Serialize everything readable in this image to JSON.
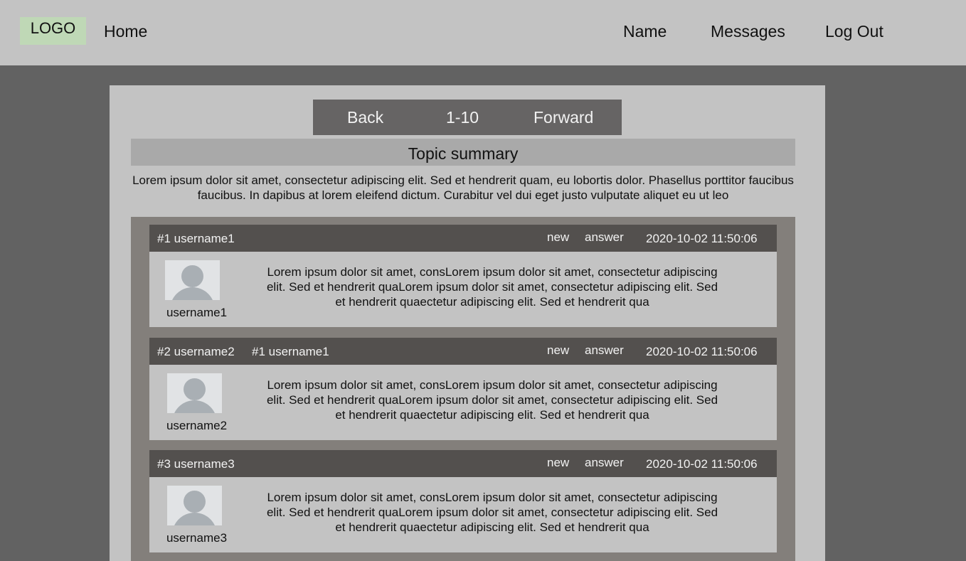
{
  "header": {
    "logo": "LOGO",
    "home": "Home",
    "name": "Name",
    "messages": "Messages",
    "logout": "Log Out"
  },
  "pager": {
    "back": "Back",
    "range": "1-10",
    "forward": "Forward"
  },
  "topic": {
    "title": "Topic summary",
    "summary": "Lorem ipsum dolor sit amet, consectetur adipiscing elit. Sed et hendrerit quam, eu lobortis dolor. Phasellus porttitor faucibus faucibus. In dapibus at lorem eleifend dictum. Curabitur vel dui eget justo vulputate aliquet eu ut leo"
  },
  "posts": [
    {
      "title": "#1 username1",
      "reply_to": "",
      "new_label": "new",
      "answer_label": "answer",
      "date": "2020-10-02 11:50:06",
      "avatar_name": "username1",
      "text": "Lorem ipsum dolor sit amet, consLorem ipsum dolor sit amet, consectetur adipiscing elit. Sed et hendrerit quaLorem ipsum dolor sit amet, consectetur adipiscing elit. Sed et hendrerit quaectetur adipiscing elit. Sed et hendrerit qua"
    },
    {
      "title": "#2 username2",
      "reply_to": "#1 username1",
      "new_label": "new",
      "answer_label": "answer",
      "date": "2020-10-02 11:50:06",
      "avatar_name": "username2",
      "text": "Lorem ipsum dolor sit amet, consLorem ipsum dolor sit amet, consectetur adipiscing elit. Sed et hendrerit quaLorem ipsum dolor sit amet, consectetur adipiscing elit. Sed et hendrerit quaectetur adipiscing elit. Sed et hendrerit qua"
    },
    {
      "title": "#3 username3",
      "reply_to": "",
      "new_label": "new",
      "answer_label": "answer",
      "date": "2020-10-02 11:50:06",
      "avatar_name": "username3",
      "text": "Lorem ipsum dolor sit amet, consLorem ipsum dolor sit amet, consectetur adipiscing elit. Sed et hendrerit quaLorem ipsum dolor sit amet, consectetur adipiscing elit. Sed et hendrerit quaectetur adipiscing elit. Sed et hendrerit qua"
    }
  ]
}
